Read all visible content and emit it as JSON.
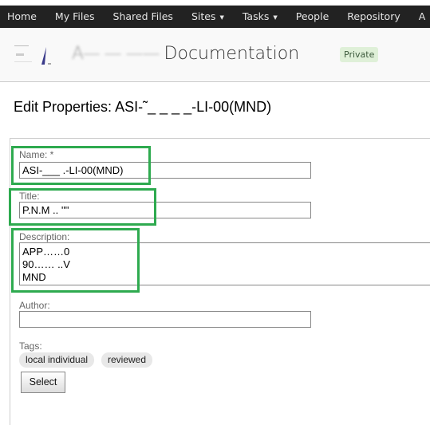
{
  "nav": {
    "items": [
      {
        "label": "Home"
      },
      {
        "label": "My Files"
      },
      {
        "label": "Shared Files"
      },
      {
        "label": "Sites",
        "dropdown": true
      },
      {
        "label": "Tasks",
        "dropdown": true
      },
      {
        "label": "People"
      },
      {
        "label": "Repository"
      },
      {
        "label": "A"
      }
    ]
  },
  "site": {
    "title_redacted": "A— — —— ",
    "title": "Documentation",
    "visibility": "Private"
  },
  "page": {
    "title": "Edit Properties: ASI-˜_ _ _ _-LI-00(MND)"
  },
  "form": {
    "name": {
      "label": "Name: *",
      "value": "ASI-___ .-LI-00(MND)"
    },
    "title": {
      "label": "Title:",
      "value": "P.N.M  ..  '\"'"
    },
    "description": {
      "label": "Description:",
      "value": "APP……0\n90…… ..V\nMND"
    },
    "author": {
      "label": "Author:",
      "value": ""
    },
    "tags": {
      "label": "Tags:",
      "items": [
        "local individual",
        "reviewed"
      ]
    },
    "select_label": "Select"
  },
  "colors": {
    "nav_bg": "#222222",
    "highlight": "#2eaa4f",
    "badge_bg": "#dff0d8"
  }
}
